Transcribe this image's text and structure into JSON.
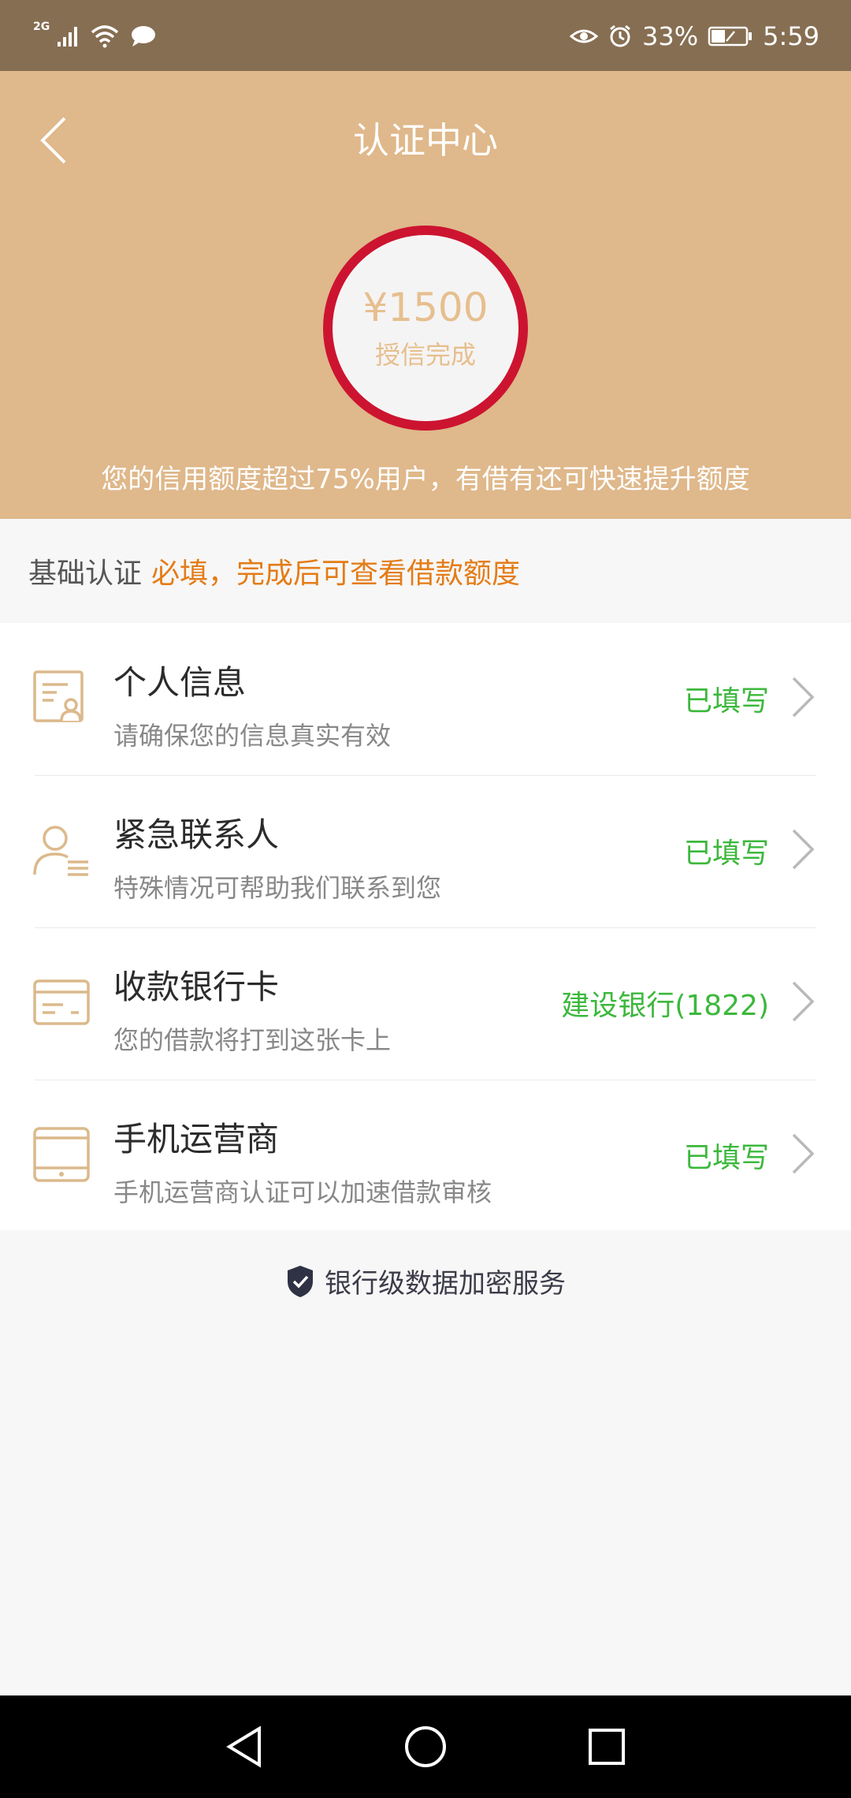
{
  "status_bar": {
    "network_type": "2G",
    "battery_percent": "33%",
    "time": "5:59"
  },
  "header": {
    "title": "认证中心",
    "credit_amount": "¥1500",
    "credit_status": "授信完成",
    "note": "您的信用额度超过75%用户，有借有还可快速提升额度"
  },
  "section": {
    "label": "基础认证",
    "required_note": "必填，完成后可查看借款额度"
  },
  "items": [
    {
      "title": "个人信息",
      "subtitle": "请确保您的信息真实有效",
      "status": "已填写",
      "icon": "id-card-icon"
    },
    {
      "title": "紧急联系人",
      "subtitle": "特殊情况可帮助我们联系到您",
      "status": "已填写",
      "icon": "contact-person-icon"
    },
    {
      "title": "收款银行卡",
      "subtitle": "您的借款将打到这张卡上",
      "status": "建设银行(1822)",
      "icon": "bank-card-icon"
    },
    {
      "title": "手机运营商",
      "subtitle": "手机运营商认证可以加速借款审核",
      "status": "已填写",
      "icon": "tablet-icon"
    }
  ],
  "security_note": "银行级数据加密服务",
  "colors": {
    "status_bar": "#866e52",
    "header_bg": "#dfb88b",
    "ring": "#cc1430",
    "required": "#e47c17",
    "success": "#3cb83c",
    "icon_accent": "#dcb98c"
  }
}
